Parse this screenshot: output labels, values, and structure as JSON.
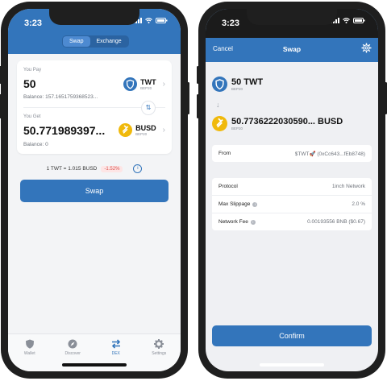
{
  "left": {
    "status_time": "3:23",
    "segment": {
      "swap": "Swap",
      "exchange": "Exchange"
    },
    "pay": {
      "label": "You Pay",
      "amount": "50",
      "token": "TWT",
      "network": "BEP20",
      "balance": "Balance: 157.1651759368523..."
    },
    "get": {
      "label": "You Get",
      "amount": "50.771989397...",
      "token": "BUSD",
      "network": "BEP20",
      "balance": "Balance: 0"
    },
    "rate": "1 TWT = 1.015 BUSD",
    "impact": "-1.52%",
    "swap_button": "Swap",
    "tabs": [
      {
        "label": "Wallet",
        "icon": "shield-icon"
      },
      {
        "label": "Discover",
        "icon": "compass-icon"
      },
      {
        "label": "DEX",
        "icon": "swap-arrows-icon"
      },
      {
        "label": "Settings",
        "icon": "gear-icon"
      }
    ]
  },
  "right": {
    "status_time": "3:23",
    "cancel": "Cancel",
    "title": "Swap",
    "from_asset": {
      "amount": "50 TWT",
      "network": "BEP20"
    },
    "to_asset": {
      "amount": "50.7736222030590... BUSD",
      "network": "BEP20"
    },
    "from_row": {
      "label": "From",
      "value": "$TWT🚀 (0xCc643...fEb8748)"
    },
    "details": [
      {
        "label": "Protocol",
        "value": "1inch Network"
      },
      {
        "label": "Max Slippage",
        "value": "2.0 %"
      },
      {
        "label": "Network Fee",
        "value": "0.00193556 BNB ($0.67)"
      }
    ],
    "confirm_button": "Confirm"
  },
  "colors": {
    "primary": "#3375bb",
    "twt": "#3375bb",
    "busd": "#f0b90b",
    "negative": "#d9534f"
  }
}
